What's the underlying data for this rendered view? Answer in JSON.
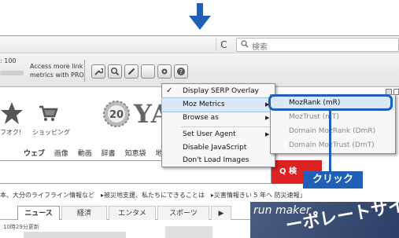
{
  "browser": {
    "reload_icon": "C",
    "search_placeholder": "検索"
  },
  "moz_toolbar": {
    "count_text": ": 100",
    "access_link_line1": "Access more link",
    "access_link_line2": "metrics with PRO",
    "buttons": [
      "wrench-icon",
      "search-icon",
      "pencil-icon",
      "blank",
      "gear-icon",
      "help-icon"
    ]
  },
  "page": {
    "store_prefix_label": "フオク!",
    "store_label": "ショッピング",
    "badge_number": "20",
    "logo": "YA",
    "search_tabs": [
      "ウェブ",
      "画像",
      "動画",
      "辞書",
      "知恵袋",
      "地図"
    ],
    "search_button_label": "Q 検",
    "info_line": "本、大分のライフライン情報など　▸被災地支援、私たちにできることは　▸災害情報きい 5 年へ 防災速報」",
    "news_tabs": [
      "ニュース",
      "経済",
      "エンタメ",
      "スポーツ",
      "▶"
    ],
    "update_time": "10時29分更新",
    "banner_brand": "run maker",
    "banner_headline": "ーポレートサイト"
  },
  "menu": {
    "items": [
      {
        "label": "Display SERP Overlay",
        "checked": true,
        "submenu": false
      },
      {
        "label": "Moz Metrics",
        "checked": false,
        "submenu": true
      },
      {
        "label": "Browse as",
        "checked": false,
        "submenu": true
      },
      {
        "label": "Set User Agent",
        "checked": false,
        "submenu": true
      },
      {
        "label": "Disable JavaScript",
        "checked": false,
        "submenu": false
      },
      {
        "label": "Don't Load Images",
        "checked": false,
        "submenu": false
      }
    ],
    "check_mark": "✓"
  },
  "submenu": {
    "items": [
      {
        "label": "MozRank (mR)"
      },
      {
        "label": "MozTrust (mT)"
      },
      {
        "label": "Domain MozRank (DmR)"
      },
      {
        "label": "Domain MozTrust (DmT)"
      }
    ]
  },
  "callout": {
    "label": "クリック"
  },
  "colors": {
    "accent_blue": "#1f5fb8",
    "menu_highlight": "#dbe8f7",
    "search_red": "#dd2222"
  }
}
